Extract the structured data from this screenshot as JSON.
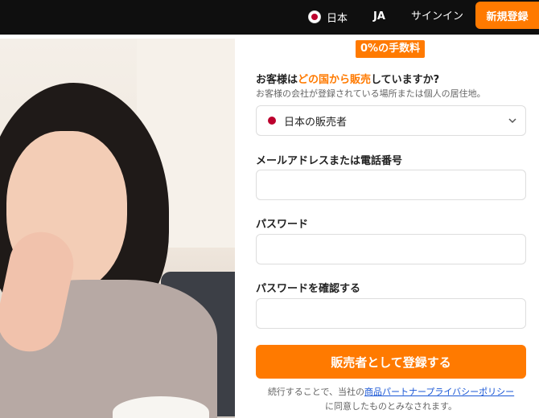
{
  "header": {
    "region_label": "日本",
    "region_flag_icon": "japan-flag-icon",
    "language": "JA",
    "signin_label": "サインイン",
    "signup_label": "新規登録",
    "accent_color": "#ff7a00"
  },
  "hero": {
    "image_description": "photo-woman-smiling"
  },
  "form": {
    "badge": "0%の手数料",
    "question_part1": "お客様は",
    "question_highlight": "どの国から販売",
    "question_part2": "していますか?",
    "question_sub": "お客様の会社が登録されている場所または個人の居住地。",
    "country_selected": "日本の販売者",
    "email_label": "メールアドレスまたは電話番号",
    "email_value": "",
    "password_label": "パスワード",
    "password_value": "",
    "confirm_label": "パスワードを確認する",
    "confirm_value": "",
    "submit_label": "販売者として登録する",
    "legal_prefix": "続行することで、当社の",
    "legal_link": "商品パートナープライバシーポリシー",
    "legal_suffix": "に同意したものとみなされます。"
  }
}
